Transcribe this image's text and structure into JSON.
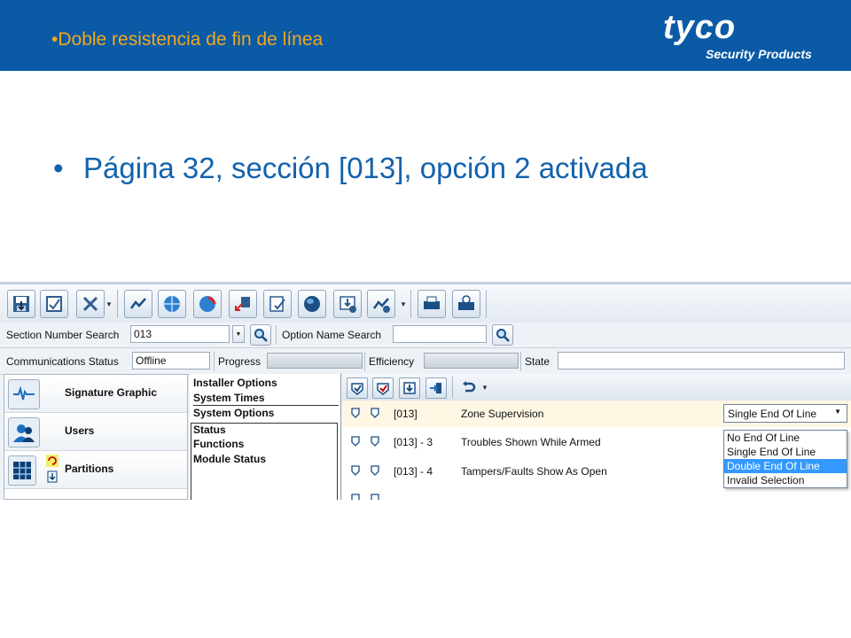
{
  "slide": {
    "header_title": "•Doble resistencia de fin de línea",
    "logo_word": "tyco",
    "logo_sub": "Security Products",
    "bullet_dot": "•",
    "bullet_text": "Página 32, sección [013], opción 2 activada"
  },
  "app": {
    "search_row": {
      "section_label": "Section Number Search",
      "section_value": "013",
      "option_label": "Option Name Search",
      "option_value": ""
    },
    "status_row": {
      "comm_label": "Communications Status",
      "comm_value": "Offline",
      "progress_label": "Progress",
      "efficiency_label": "Efficiency",
      "state_label": "State",
      "state_value": ""
    },
    "nav": [
      {
        "label": "Signature Graphic",
        "icon": "waveform-icon"
      },
      {
        "label": "Users",
        "icon": "users-icon"
      },
      {
        "label": "Partitions",
        "icon": "partitions-icon"
      }
    ],
    "options": [
      "Installer Options",
      "System Times",
      "System Options",
      "Status",
      "Functions",
      "Module Status"
    ],
    "grid_rows": [
      {
        "section": "[013]",
        "name": "Zone Supervision",
        "value": "Single End Of Line"
      },
      {
        "section": "[013] - 3",
        "name": "Troubles Shown While Armed"
      },
      {
        "section": "[013] - 4",
        "name": "Tampers/Faults Show As Open"
      }
    ],
    "dropdown_options": [
      "No End Of Line",
      "Single End Of Line",
      "Double End Of Line",
      "Invalid Selection"
    ],
    "dropdown_highlighted": "Double End Of Line",
    "colors": {
      "header_bg": "#0a5aa6",
      "header_title": "#f2a71d",
      "bullet_text": "#1262ad",
      "selection": "#3399ff"
    }
  }
}
